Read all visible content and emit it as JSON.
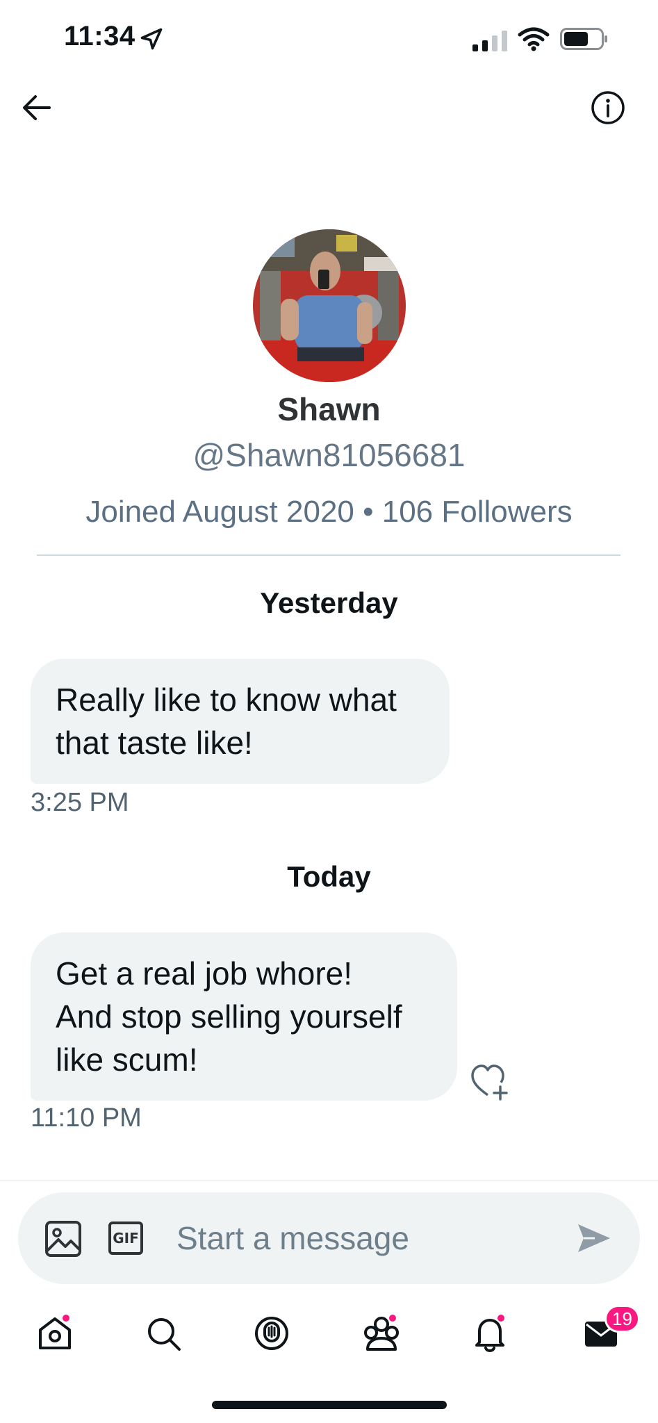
{
  "status_bar": {
    "time": "11:34"
  },
  "profile": {
    "name": "Shawn",
    "handle": "@Shawn81056681",
    "meta": "Joined August 2020 • 106 Followers"
  },
  "conversation": [
    {
      "day": "Yesterday",
      "message_lines": [
        "Really like to know what",
        "that taste like!"
      ],
      "time": "3:25 PM"
    },
    {
      "day": "Today",
      "message_lines": [
        "Get a real job whore!",
        "And stop selling yourself",
        "like scum!"
      ],
      "time": "11:10 PM"
    }
  ],
  "composer": {
    "placeholder": "Start a message",
    "gif_label": "GIF"
  },
  "tab_bar": {
    "messages_badge": "19"
  },
  "colors": {
    "bubble": "#eff3f4",
    "accent_pink": "#f91880",
    "muted_text": "#536471"
  },
  "icons": [
    "back-arrow-icon",
    "info-icon",
    "image-icon",
    "gif-icon",
    "send-icon",
    "heart-add-icon",
    "home-icon",
    "search-icon",
    "spaces-icon",
    "communities-icon",
    "bell-icon",
    "mail-icon"
  ]
}
